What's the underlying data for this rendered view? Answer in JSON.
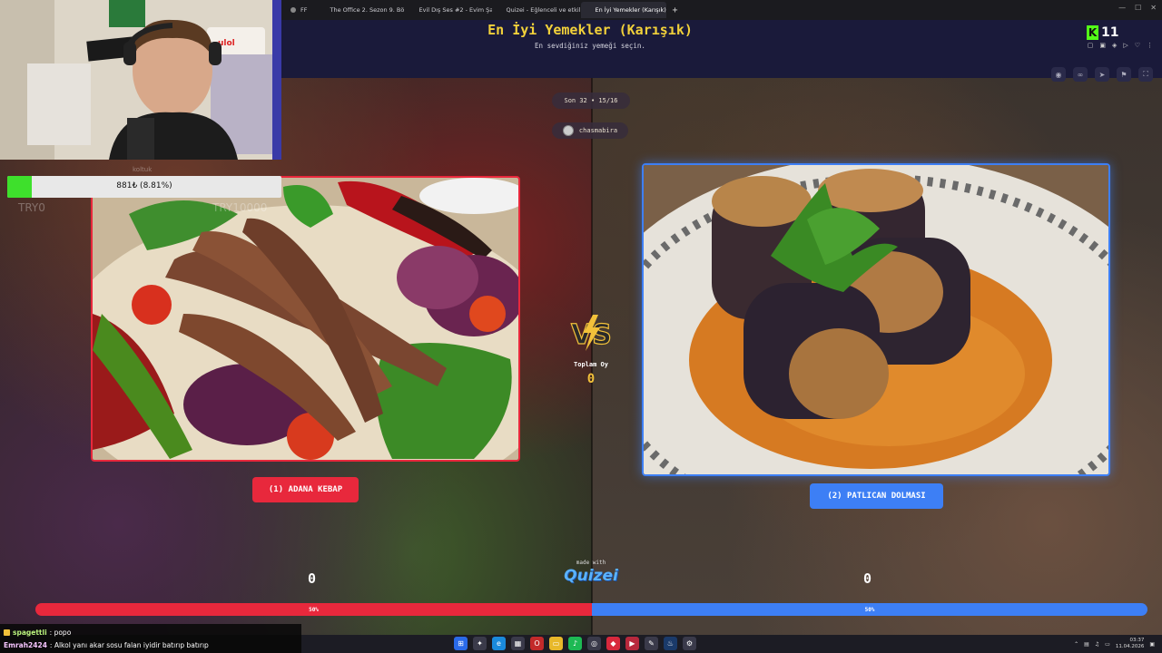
{
  "browser": {
    "tabs": [
      {
        "label": "FF",
        "color": "#888888",
        "active": false
      },
      {
        "label": "The Office 2. Sezon 9. Bö",
        "color": "#ffffff",
        "active": false
      },
      {
        "label": "Evil Dış Ses #2 - Evim Şal",
        "color": "#e8283c",
        "active": false
      },
      {
        "label": "Quizei - Eğlenceli ve etkil",
        "color": "#f2c13a",
        "active": false
      },
      {
        "label": "En İyi Yemekler (Karışık)",
        "color": "#f2c13a",
        "active": true
      }
    ],
    "new_tab": "+"
  },
  "kick": {
    "logo": "K",
    "viewers": "11"
  },
  "page": {
    "title": "En İyi Yemekler (Karışık)",
    "subtitle": "En sevdiğiniz yemeği seçin.",
    "round": "Son 32 • 15/16",
    "creator": "chasmabira"
  },
  "options": {
    "left": {
      "label": "(1) ADANA KEBAP",
      "votes": "0",
      "percent_label": "50%",
      "percent": 50,
      "color": "#e8283c"
    },
    "right": {
      "label": "(2) PATLICAN DOLMASI",
      "votes": "0",
      "percent_label": "50%",
      "percent": 50,
      "color": "#3d7ff5"
    }
  },
  "total": {
    "label": "Toplam Oy",
    "value": "0"
  },
  "footer": {
    "made_with": "made with",
    "brand": "Quizei"
  },
  "stream": {
    "goal_text": "881₺ (8.81%)",
    "goal_percent": 8.81,
    "overlay_try0": "TRY0",
    "overlay_try10000": "TRY10000",
    "overlay_small": "koltuk"
  },
  "chat": [
    {
      "user": "spagettli",
      "message": ": popo"
    },
    {
      "user": "Emrah2424",
      "message": ": Alkol yanı akar sosu falan iyidir batırıp batırıp"
    }
  ],
  "taskbar": {
    "time": "03:37",
    "date": "11.04.2026"
  },
  "icons": {
    "header": [
      "eye-icon",
      "link-icon",
      "send-icon",
      "flag-icon",
      "fullscreen-icon"
    ]
  }
}
